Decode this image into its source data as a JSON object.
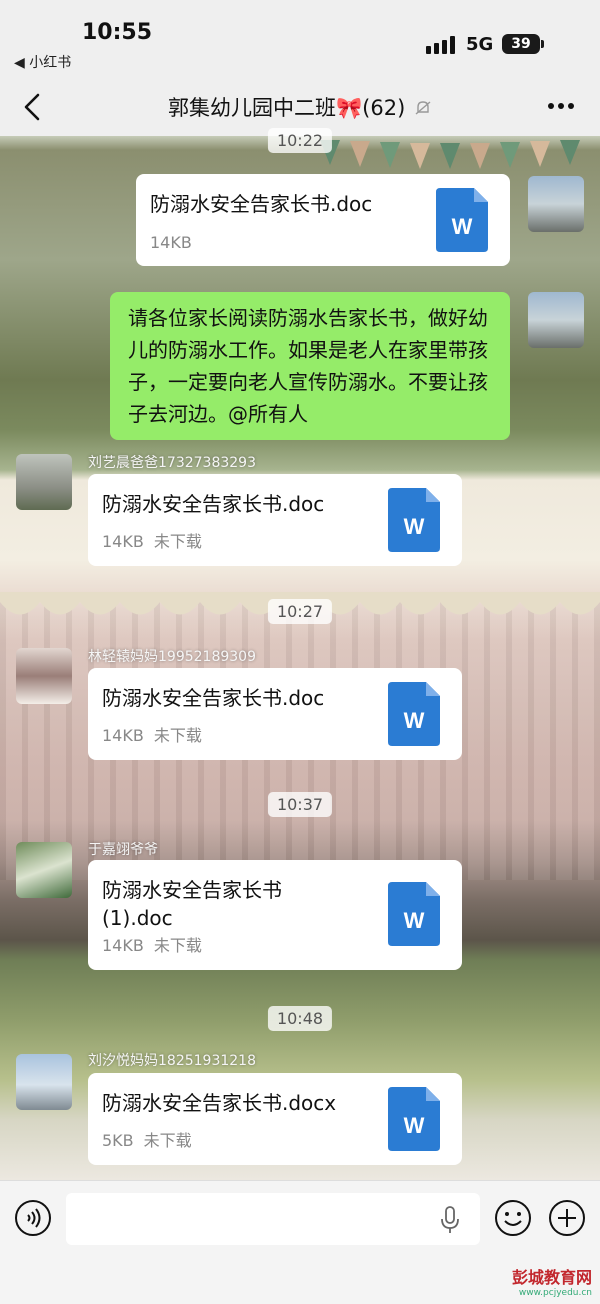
{
  "status": {
    "time": "10:55",
    "back_app": "◀ 小红书",
    "network": "5G",
    "battery": "39"
  },
  "header": {
    "title": "郭集幼儿园中二班🎀(62)"
  },
  "messages": {
    "ts1": "10:22",
    "m1": {
      "file": "防溺水安全告家长书.doc",
      "size": "14KB"
    },
    "m2": {
      "text": "请各位家长阅读防溺水告家长书，做好幼儿的防溺水工作。如果是老人在家里带孩子，一定要向老人宣传防溺水。不要让孩子去河边。@所有人"
    },
    "m3": {
      "sender": "刘艺晨爸爸17327383293",
      "file": "防溺水安全告家长书.doc",
      "size": "14KB",
      "status": "未下载"
    },
    "ts2": "10:27",
    "m4": {
      "sender": "林轻辕妈妈19952189309",
      "file": "防溺水安全告家长书.doc",
      "size": "14KB",
      "status": "未下载"
    },
    "ts3": "10:37",
    "m5": {
      "sender": "于嘉翊爷爷",
      "file": "防溺水安全告家长书\n(1).doc",
      "size": "14KB",
      "status": "未下载"
    },
    "ts4": "10:48",
    "m6": {
      "sender": "刘汐悦妈妈18251931218",
      "file": "防溺水安全告家长书.docx",
      "size": "5KB",
      "status": "未下载"
    }
  },
  "input": {
    "placeholder": ""
  },
  "file_icon_letter": "W",
  "watermark": {
    "text": "彭城教育网",
    "sub": "www.pcjyedu.cn"
  },
  "colors": {
    "bubble_green": "#95ec69",
    "word_blue": "#2b7cd3"
  }
}
